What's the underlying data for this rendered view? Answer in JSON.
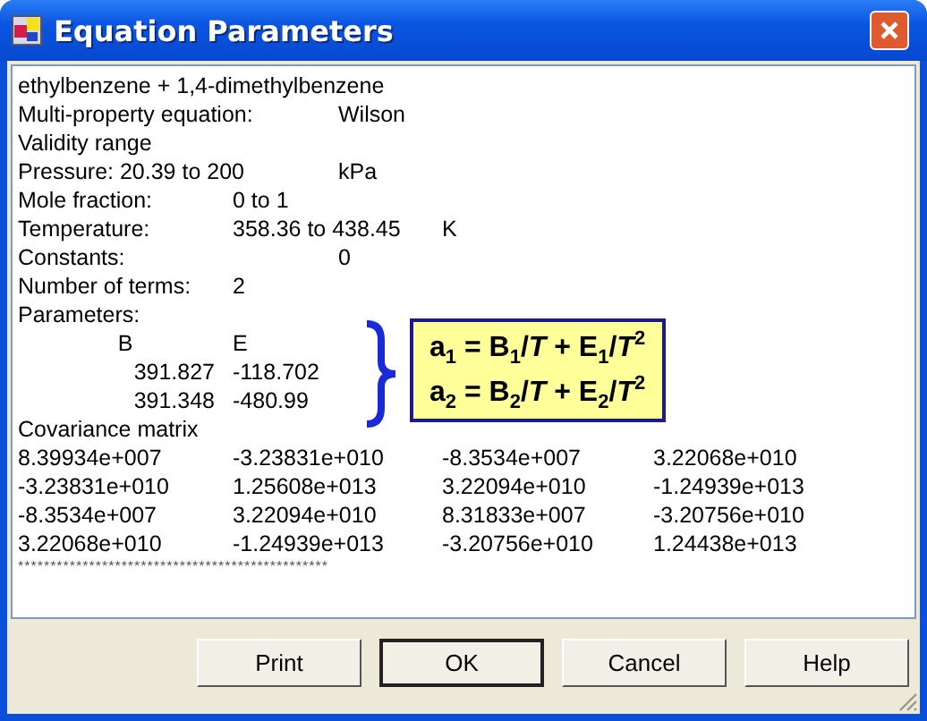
{
  "window": {
    "title": "Equation Parameters"
  },
  "lines": [
    {
      "kind": "heading",
      "cells": [
        "ethylbenzene + 1,4-dimethylbenzene"
      ]
    },
    {
      "kind": "label_far_value",
      "cells": [
        "Multi-property equation:",
        "Wilson"
      ]
    },
    {
      "kind": "heading",
      "cells": [
        "Validity range"
      ]
    },
    {
      "kind": "label_far_value",
      "cells": [
        "Pressure:  20.39 to 200",
        "kPa"
      ]
    },
    {
      "kind": "label_value",
      "cells": [
        "Mole fraction:",
        "0 to 1"
      ]
    },
    {
      "kind": "label_value_unit",
      "cells": [
        "Temperature:",
        "358.36 to 438.45",
        "K"
      ]
    },
    {
      "kind": "label_far_value",
      "cells": [
        "Constants:",
        "0"
      ]
    },
    {
      "kind": "label_value",
      "cells": [
        "Number of terms:",
        "2"
      ]
    },
    {
      "kind": "heading",
      "cells": [
        "Parameters:"
      ]
    },
    {
      "kind": "parameter_header",
      "cells": [
        "B",
        "E"
      ]
    },
    {
      "kind": "parameter_row",
      "cells": [
        "391.827",
        "-118.702"
      ]
    },
    {
      "kind": "parameter_row",
      "cells": [
        "391.348",
        "-480.99"
      ]
    },
    {
      "kind": "heading",
      "cells": [
        "Covariance matrix"
      ]
    },
    {
      "kind": "matrix_row",
      "cells": [
        "8.39934e+007",
        "-3.23831e+010",
        "-8.3534e+007",
        "3.22068e+010"
      ]
    },
    {
      "kind": "matrix_row",
      "cells": [
        "-3.23831e+010",
        "1.25608e+013",
        "3.22094e+010",
        "-1.24939e+013"
      ]
    },
    {
      "kind": "matrix_row",
      "cells": [
        "-8.3534e+007",
        "3.22094e+010",
        "8.31833e+007",
        "-3.20756e+010"
      ]
    },
    {
      "kind": "matrix_row",
      "cells": [
        "3.22068e+010",
        "-1.24939e+013",
        "-3.20756e+010",
        "1.24438e+013"
      ]
    },
    {
      "kind": "separator",
      "cells": [
        "************************************************"
      ]
    }
  ],
  "callout": {
    "equations": [
      "a$_{1}$ = B$_{1}$/*T* + E$_{1}$/*T*$^{2}$",
      "a$_{2}$ = B$_{2}$/*T* + E$_{2}$/*T*$^{2}$"
    ]
  },
  "buttons": [
    {
      "label": "Print",
      "default": false
    },
    {
      "label": "OK",
      "default": true
    },
    {
      "label": "Cancel",
      "default": false
    },
    {
      "label": "Help",
      "default": false
    }
  ]
}
